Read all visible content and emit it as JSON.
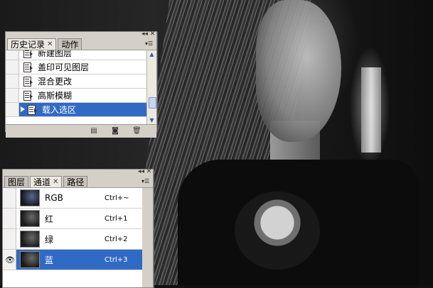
{
  "history_panel": {
    "tabs": [
      {
        "label": "历史记录",
        "active": true,
        "closable": true
      },
      {
        "label": "动作",
        "active": false,
        "closable": false
      }
    ],
    "rows": [
      {
        "label": "新建图层",
        "selected": false
      },
      {
        "label": "盖印可见图层",
        "selected": false
      },
      {
        "label": "混合更改",
        "selected": false
      },
      {
        "label": "高斯模糊",
        "selected": false
      },
      {
        "label": "载入选区",
        "selected": true
      }
    ],
    "footer_icons": [
      "new-document-icon",
      "new-snapshot-icon",
      "delete-icon"
    ]
  },
  "channels_panel": {
    "tabs": [
      {
        "label": "图层",
        "active": false,
        "closable": false
      },
      {
        "label": "通道",
        "active": true,
        "closable": true
      },
      {
        "label": "路径",
        "active": false,
        "closable": false
      }
    ],
    "rows": [
      {
        "label": "RGB",
        "shortcut": "Ctrl+~",
        "visible": false,
        "selected": false
      },
      {
        "label": "红",
        "shortcut": "Ctrl+1",
        "visible": false,
        "selected": false
      },
      {
        "label": "绿",
        "shortcut": "Ctrl+2",
        "visible": false,
        "selected": false
      },
      {
        "label": "蓝",
        "shortcut": "Ctrl+3",
        "visible": true,
        "selected": true
      }
    ]
  },
  "colors": {
    "selection": "#316ac5",
    "panel_bg": "#d4d0c8"
  }
}
